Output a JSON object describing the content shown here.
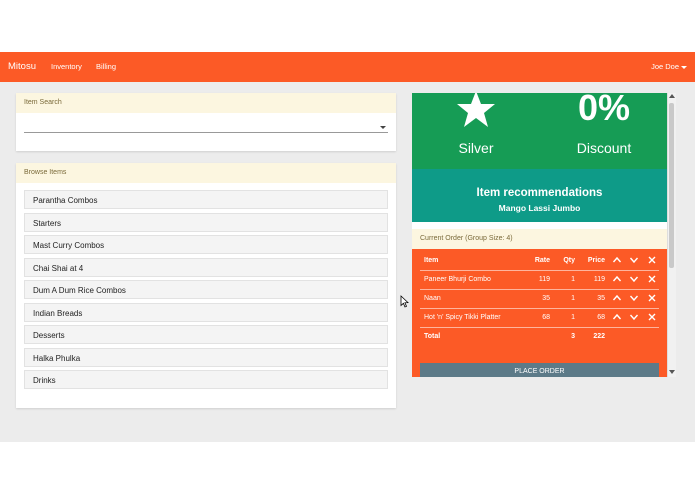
{
  "navbar": {
    "brand": "Mitosu",
    "links": [
      "Inventory",
      "Billing"
    ],
    "user": "Joe Doe"
  },
  "item_search": {
    "title": "Item Search",
    "value": ""
  },
  "browse": {
    "title": "Browse Items",
    "items": [
      "Parantha Combos",
      "Starters",
      "Mast Curry Combos",
      "Chai Shai at 4",
      "Dum A Dum Rice Combos",
      "Indian Breads",
      "Desserts",
      "Halka Phulka",
      "Drinks"
    ]
  },
  "loyalty": {
    "tier": "Silver",
    "discount_value": "0%",
    "discount_label": "Discount",
    "tier_icon": "star-icon"
  },
  "recommendation": {
    "title": "Item recommendations",
    "item": "Mango Lassi Jumbo"
  },
  "order": {
    "header": "Current Order (Group Size: 4)",
    "columns": {
      "item": "Item",
      "rate": "Rate",
      "qty": "Qty",
      "price": "Price"
    },
    "rows": [
      {
        "item": "Paneer Bhurji Combo",
        "rate": "119",
        "qty": "1",
        "price": "119"
      },
      {
        "item": "Naan",
        "rate": "35",
        "qty": "1",
        "price": "35"
      },
      {
        "item": "Hot 'n' Spicy Tikki Platter",
        "rate": "68",
        "qty": "1",
        "price": "68"
      }
    ],
    "total": {
      "label": "Total",
      "qty": "3",
      "price": "222"
    },
    "place_order": "PLACE ORDER"
  },
  "colors": {
    "nav": "#fc5a26",
    "green": "#169c55",
    "teal": "#0e9b88",
    "order": "#fc5a26",
    "button": "#5c7a88",
    "card_header": "#fcf6e0"
  }
}
